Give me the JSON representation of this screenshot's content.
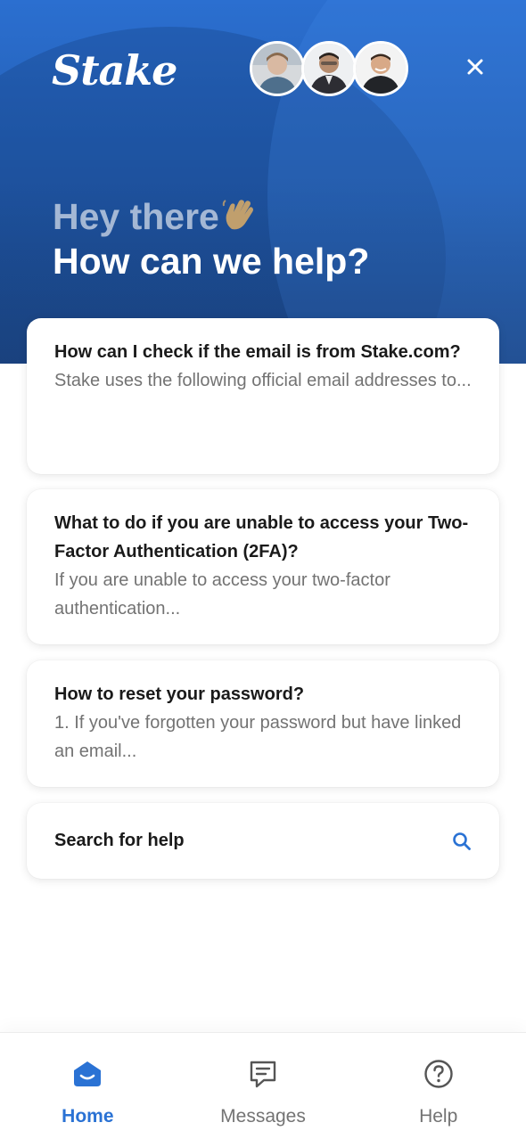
{
  "header": {
    "logo_text": "Stake",
    "greeting": "Hey there",
    "greeting_emoji": "wave-emoji",
    "headline": "How can we help?",
    "avatars": [
      "avatar-1",
      "avatar-2",
      "avatar-3"
    ],
    "close_icon": "close-icon",
    "colors": {
      "gradient_top": "#2b6fd0",
      "gradient_bottom": "#1f4f92"
    }
  },
  "articles": [
    {
      "title": "How can I check if the email is from Stake.com?",
      "excerpt": "Stake uses the following official email addresses to..."
    },
    {
      "title": "What to do if you are unable to access your Two-Factor Authentication (2FA)?",
      "excerpt": "If you are unable to access your two-factor authentication..."
    },
    {
      "title": "How to reset your password?",
      "excerpt": "1. If you've forgotten your password but have linked an email..."
    }
  ],
  "search": {
    "label": "Search for help",
    "icon": "search-icon"
  },
  "nav": {
    "items": [
      {
        "label": "Home",
        "icon": "home-icon",
        "active": true
      },
      {
        "label": "Messages",
        "icon": "messages-icon",
        "active": false
      },
      {
        "label": "Help",
        "icon": "help-icon",
        "active": false
      }
    ],
    "accent_color": "#2a72d4"
  }
}
